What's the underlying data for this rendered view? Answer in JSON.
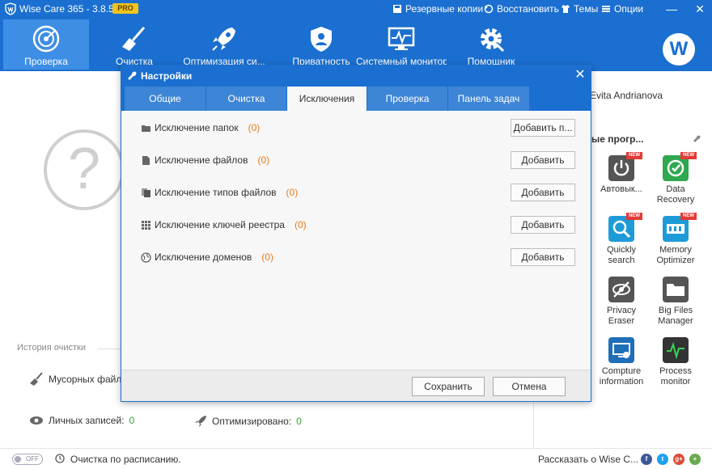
{
  "app": {
    "title": "Wise Care 365 - 3.8.5",
    "badge": "PRO",
    "accent": "#1b6fd0"
  },
  "top_links": [
    {
      "label": "Резервные копии",
      "icon": "backup-icon"
    },
    {
      "label": "Восстановить",
      "icon": "restore-icon"
    },
    {
      "label": "Темы",
      "icon": "shirt-icon"
    },
    {
      "label": "Опции",
      "icon": "menu-icon"
    }
  ],
  "window_buttons": {
    "minimize": "—",
    "close": "✕"
  },
  "nav": [
    {
      "label": "Проверка",
      "icon": "radar-icon"
    },
    {
      "label": "Очистка",
      "icon": "broom-icon"
    },
    {
      "label": "Оптимизация си...",
      "icon": "rocket-icon"
    },
    {
      "label": "Приватность",
      "icon": "shield-icon"
    },
    {
      "label": "Системный монитор",
      "icon": "monitor-icon"
    },
    {
      "label": "Помощник",
      "icon": "gear-icon"
    }
  ],
  "avatar": {
    "letter": "W"
  },
  "main": {
    "question_mark": "?",
    "history_title": "История очистки",
    "junk_label": "Мусорных файлов",
    "privacy_label": "Личных записей:",
    "privacy_value": "0",
    "optimized_label": "Оптимизировано:",
    "optimized_value": "0"
  },
  "right_panel": {
    "user_name": "Evita Andrianova",
    "tools_title": "ые прогр...",
    "tools": [
      {
        "label": "Автовык...",
        "icon": "power-icon",
        "color": "#555555",
        "new": "NEW"
      },
      {
        "label": "Data Recovery",
        "icon": "data-recovery-icon",
        "color": "#2fa84f",
        "new": "NEW"
      },
      {
        "label": "Quickly search",
        "icon": "search-icon",
        "color": "#1e9bd7",
        "new": "NEW"
      },
      {
        "label": "Memory Optimizer",
        "icon": "memory-icon",
        "color": "#1e9bd7",
        "new": "NEW"
      },
      {
        "label": "Privacy Eraser",
        "icon": "eye-off-icon",
        "color": "#555555",
        "new": ""
      },
      {
        "label": "Big Files Manager",
        "icon": "folder-icon",
        "color": "#555555",
        "new": ""
      },
      {
        "label": "Compture information",
        "icon": "computer-info-icon",
        "color": "#1e6fb8",
        "new": ""
      },
      {
        "label": "Process monitor",
        "icon": "process-icon",
        "color": "#333333",
        "new": ""
      }
    ]
  },
  "status": {
    "toggle": "OFF",
    "schedule": "Очистка по расписанию.",
    "share": "Рассказать о Wise C...",
    "social": [
      "f",
      "t",
      "g+",
      "+"
    ]
  },
  "dialog": {
    "title": "Настройки",
    "close": "✕",
    "tabs": [
      "Общие",
      "Очистка",
      "Исключения",
      "Проверка",
      "Панель задач"
    ],
    "active_tab": "Исключения",
    "rows": [
      {
        "label": "Исключение папок",
        "count": "(0)",
        "button": "Добавить п...",
        "icon": "folder-icon"
      },
      {
        "label": "Исключение файлов",
        "count": "(0)",
        "button": "Добавить",
        "icon": "file-icon"
      },
      {
        "label": "Исключение типов файлов",
        "count": "(0)",
        "button": "Добавить",
        "icon": "file-types-icon"
      },
      {
        "label": "Исключение ключей реестра",
        "count": "(0)",
        "button": "Добавить",
        "icon": "registry-icon"
      },
      {
        "label": "Исключение доменов",
        "count": "(0)",
        "button": "Добавить",
        "icon": "globe-icon"
      }
    ],
    "save": "Сохранить",
    "cancel": "Отмена"
  }
}
